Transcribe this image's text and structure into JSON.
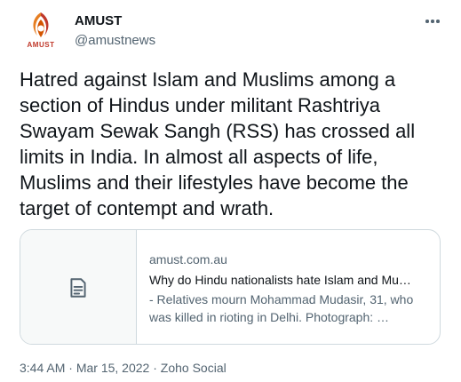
{
  "author": {
    "name": "AMUST",
    "handle": "@amustnews",
    "avatar_label": "AMUST",
    "brand_color": "#c0392b"
  },
  "more_icon": "more-horizontal-icon",
  "tweet": {
    "text": "Hatred against Islam and Muslims among a section of Hindus under militant Rashtriya Swayam Sewak Sangh (RSS) has crossed all limits in India. In almost all aspects of life, Muslims and their lifestyles have become the target of contempt and wrath."
  },
  "card": {
    "thumb_icon": "document-icon",
    "domain": "amust.com.au",
    "title": "Why do Hindu nationalists hate Islam and Mu…",
    "description": "- Relatives mourn Mohammad Mudasir, 31, who was killed in rioting in Delhi. Photograph: …"
  },
  "footer": {
    "time": "3:44 AM",
    "sep1": " · ",
    "date": "Mar 15, 2022",
    "sep2": " · ",
    "source": "Zoho Social"
  }
}
